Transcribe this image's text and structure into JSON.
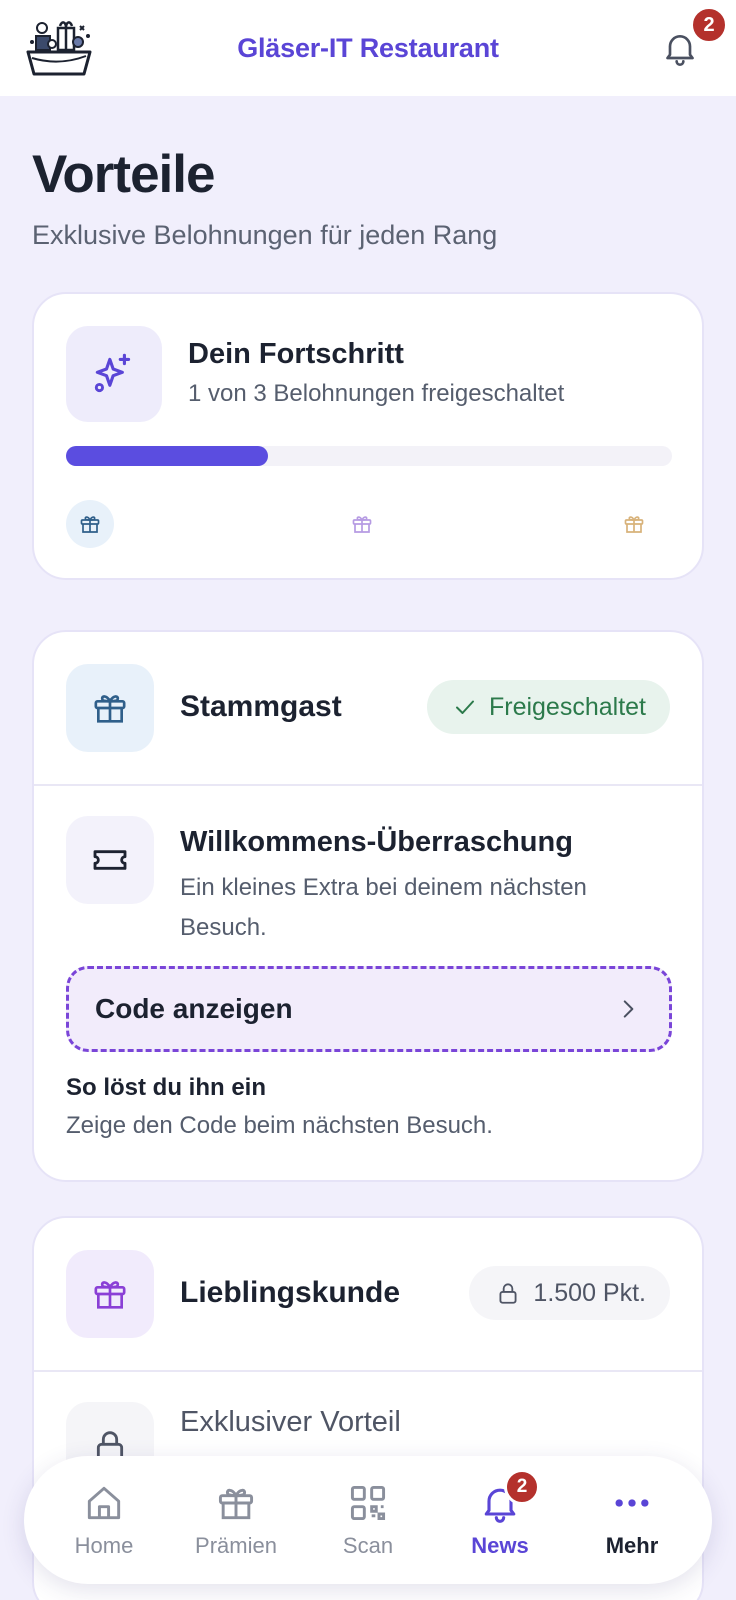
{
  "header": {
    "app_title": "Gläser-IT Restaurant",
    "notification_count": "2"
  },
  "page": {
    "title": "Vorteile",
    "subtitle": "Exklusive Belohnungen für jeden Rang"
  },
  "progress": {
    "title": "Dein Fortschritt",
    "subtitle": "1 von 3 Belohnungen freigeschaltet",
    "fraction": 0.333,
    "milestones": [
      {
        "icon": "gift-icon",
        "color": "#2f5f8a",
        "bg": "#e8f1fa"
      },
      {
        "icon": "gift-icon",
        "color": "#b69be3",
        "bg": "#ffffff"
      },
      {
        "icon": "gift-icon",
        "color": "#d8b27a",
        "bg": "#ffffff"
      }
    ]
  },
  "tiers": [
    {
      "name": "Stammgast",
      "status": "Freigeschaltet",
      "icon": "gift-icon",
      "reward": {
        "title": "Willkommens-Überraschung",
        "description": "Ein kleines Extra bei deinem nächsten Besuch.",
        "icon": "ticket-icon",
        "code_button": "Code anzeigen",
        "redeem_title": "So löst du ihn ein",
        "redeem_text": "Zeige den Code beim nächsten Besuch."
      }
    },
    {
      "name": "Lieblingskunde",
      "status": "1.500 Pkt.",
      "icon": "gift-icon",
      "reward": {
        "title": "Exklusiver Vorteil",
        "icon": "lock-icon"
      }
    }
  ],
  "nav": {
    "items": [
      {
        "label": "Home",
        "icon": "home-icon"
      },
      {
        "label": "Prämien",
        "icon": "gift-icon"
      },
      {
        "label": "Scan",
        "icon": "qr-code-icon"
      },
      {
        "label": "News",
        "icon": "bell-icon",
        "badge": "2",
        "active": true
      },
      {
        "label": "Mehr",
        "icon": "more-icon"
      }
    ]
  },
  "colors": {
    "accent": "#5a45d6",
    "progress_fill": "#5b4de0",
    "unlocked": "#2c7a4b",
    "badge": "#b4312c"
  }
}
